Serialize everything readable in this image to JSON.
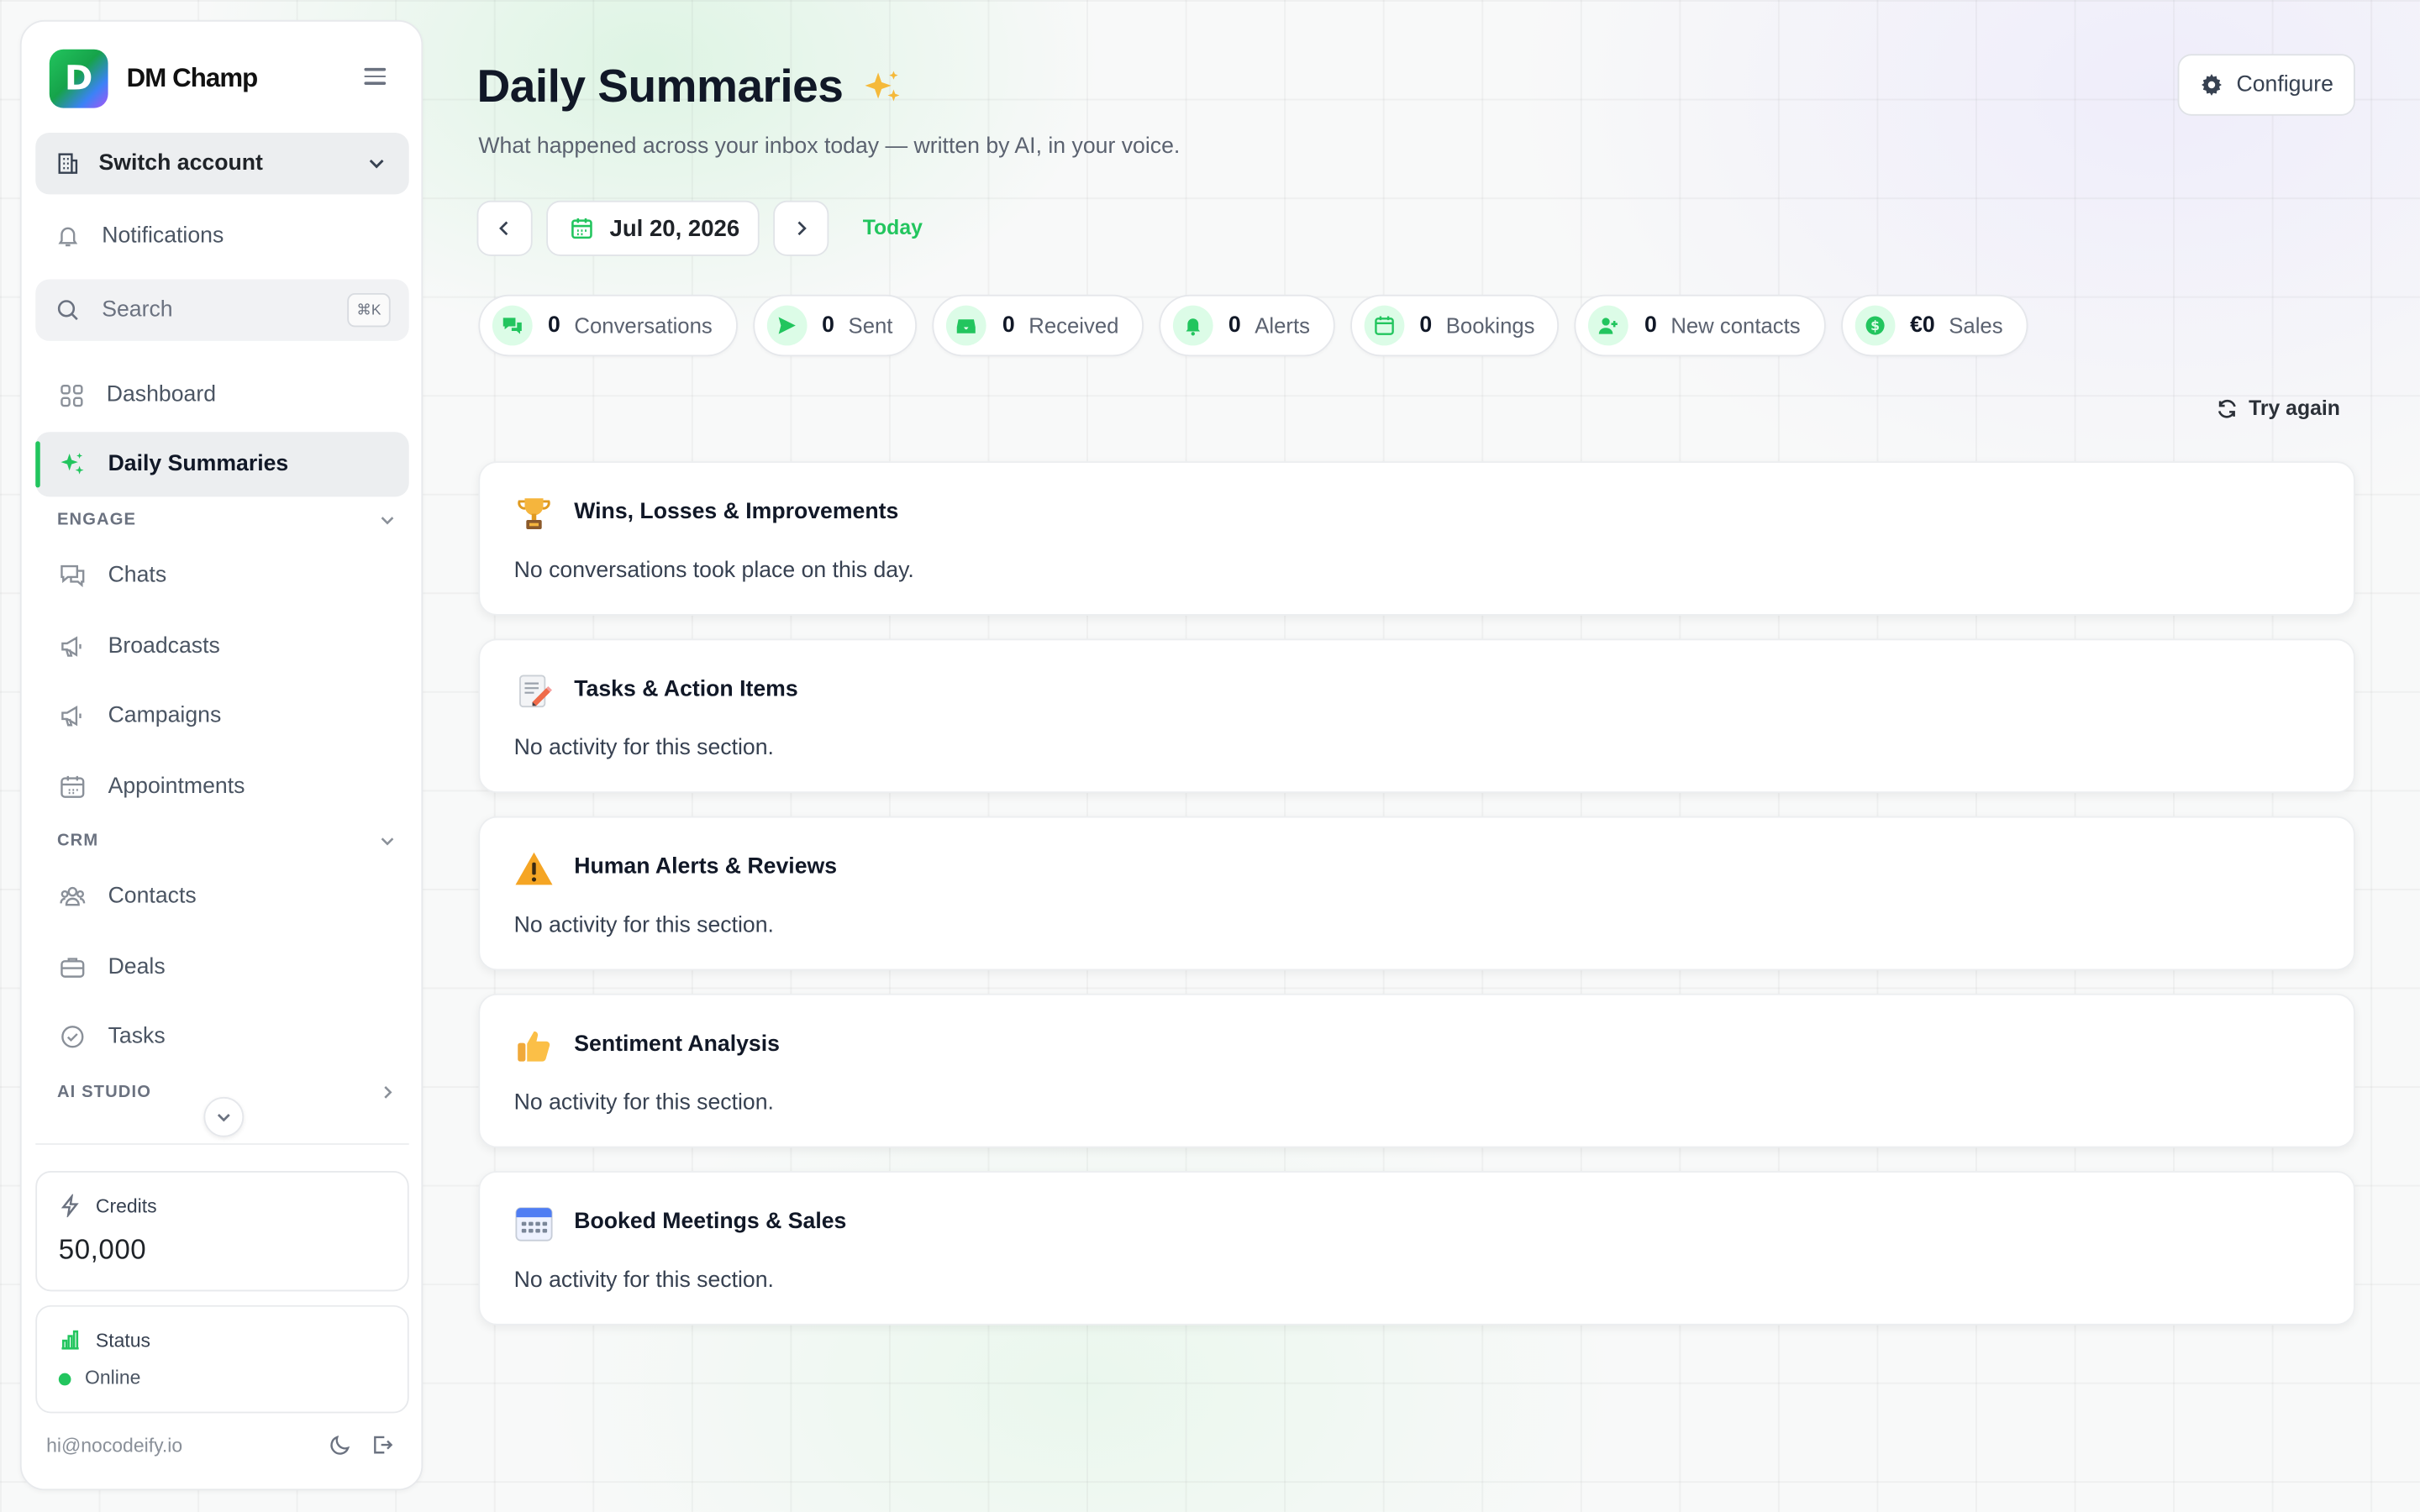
{
  "app": {
    "name": "DM Champ",
    "logo_letter": "D"
  },
  "sidebar": {
    "switch_account": "Switch account",
    "notifications": "Notifications",
    "search": {
      "placeholder": "Search",
      "shortcut": "⌘K"
    },
    "items": [
      {
        "label": "Dashboard"
      },
      {
        "label": "Daily Summaries",
        "active": true
      }
    ],
    "engage": {
      "title": "ENGAGE",
      "items": [
        {
          "label": "Chats"
        },
        {
          "label": "Broadcasts"
        },
        {
          "label": "Campaigns"
        },
        {
          "label": "Appointments"
        }
      ]
    },
    "crm": {
      "title": "CRM",
      "items": [
        {
          "label": "Contacts"
        },
        {
          "label": "Deals"
        },
        {
          "label": "Tasks"
        }
      ]
    },
    "ai_studio": {
      "title": "AI STUDIO"
    },
    "credits": {
      "label": "Credits",
      "value": "50,000"
    },
    "status": {
      "label": "Status",
      "value": "Online"
    },
    "email": "hi@nocodeify.io"
  },
  "header": {
    "title": "Daily Summaries",
    "subtitle": "What happened across your inbox today — written by AI, in your voice.",
    "configure": "Configure"
  },
  "date_nav": {
    "date": "Jul 20, 2026",
    "today": "Today"
  },
  "stats": [
    {
      "value": "0",
      "label": "Conversations",
      "icon": "chat-bubbles-icon"
    },
    {
      "value": "0",
      "label": "Sent",
      "icon": "send-icon"
    },
    {
      "value": "0",
      "label": "Received",
      "icon": "inbox-icon"
    },
    {
      "value": "0",
      "label": "Alerts",
      "icon": "bell-icon"
    },
    {
      "value": "0",
      "label": "Bookings",
      "icon": "calendar-icon"
    },
    {
      "value": "0",
      "label": "New contacts",
      "icon": "user-plus-icon"
    },
    {
      "value": "€0",
      "label": "Sales",
      "icon": "dollar-icon"
    }
  ],
  "try_again": "Try again",
  "sections": [
    {
      "title": "Wins, Losses & Improvements",
      "text": "No conversations took place on this day.",
      "icon": "trophy-icon"
    },
    {
      "title": "Tasks & Action Items",
      "text": "No activity for this section.",
      "icon": "memo-icon"
    },
    {
      "title": "Human Alerts & Reviews",
      "text": "No activity for this section.",
      "icon": "warning-icon"
    },
    {
      "title": "Sentiment Analysis",
      "text": "No activity for this section.",
      "icon": "thumbs-up-icon"
    },
    {
      "title": "Booked Meetings & Sales",
      "text": "No activity for this section.",
      "icon": "calendar-icon"
    }
  ],
  "colors": {
    "accent": "#22c55e",
    "chip_icon_bg": "#dcfce7"
  }
}
